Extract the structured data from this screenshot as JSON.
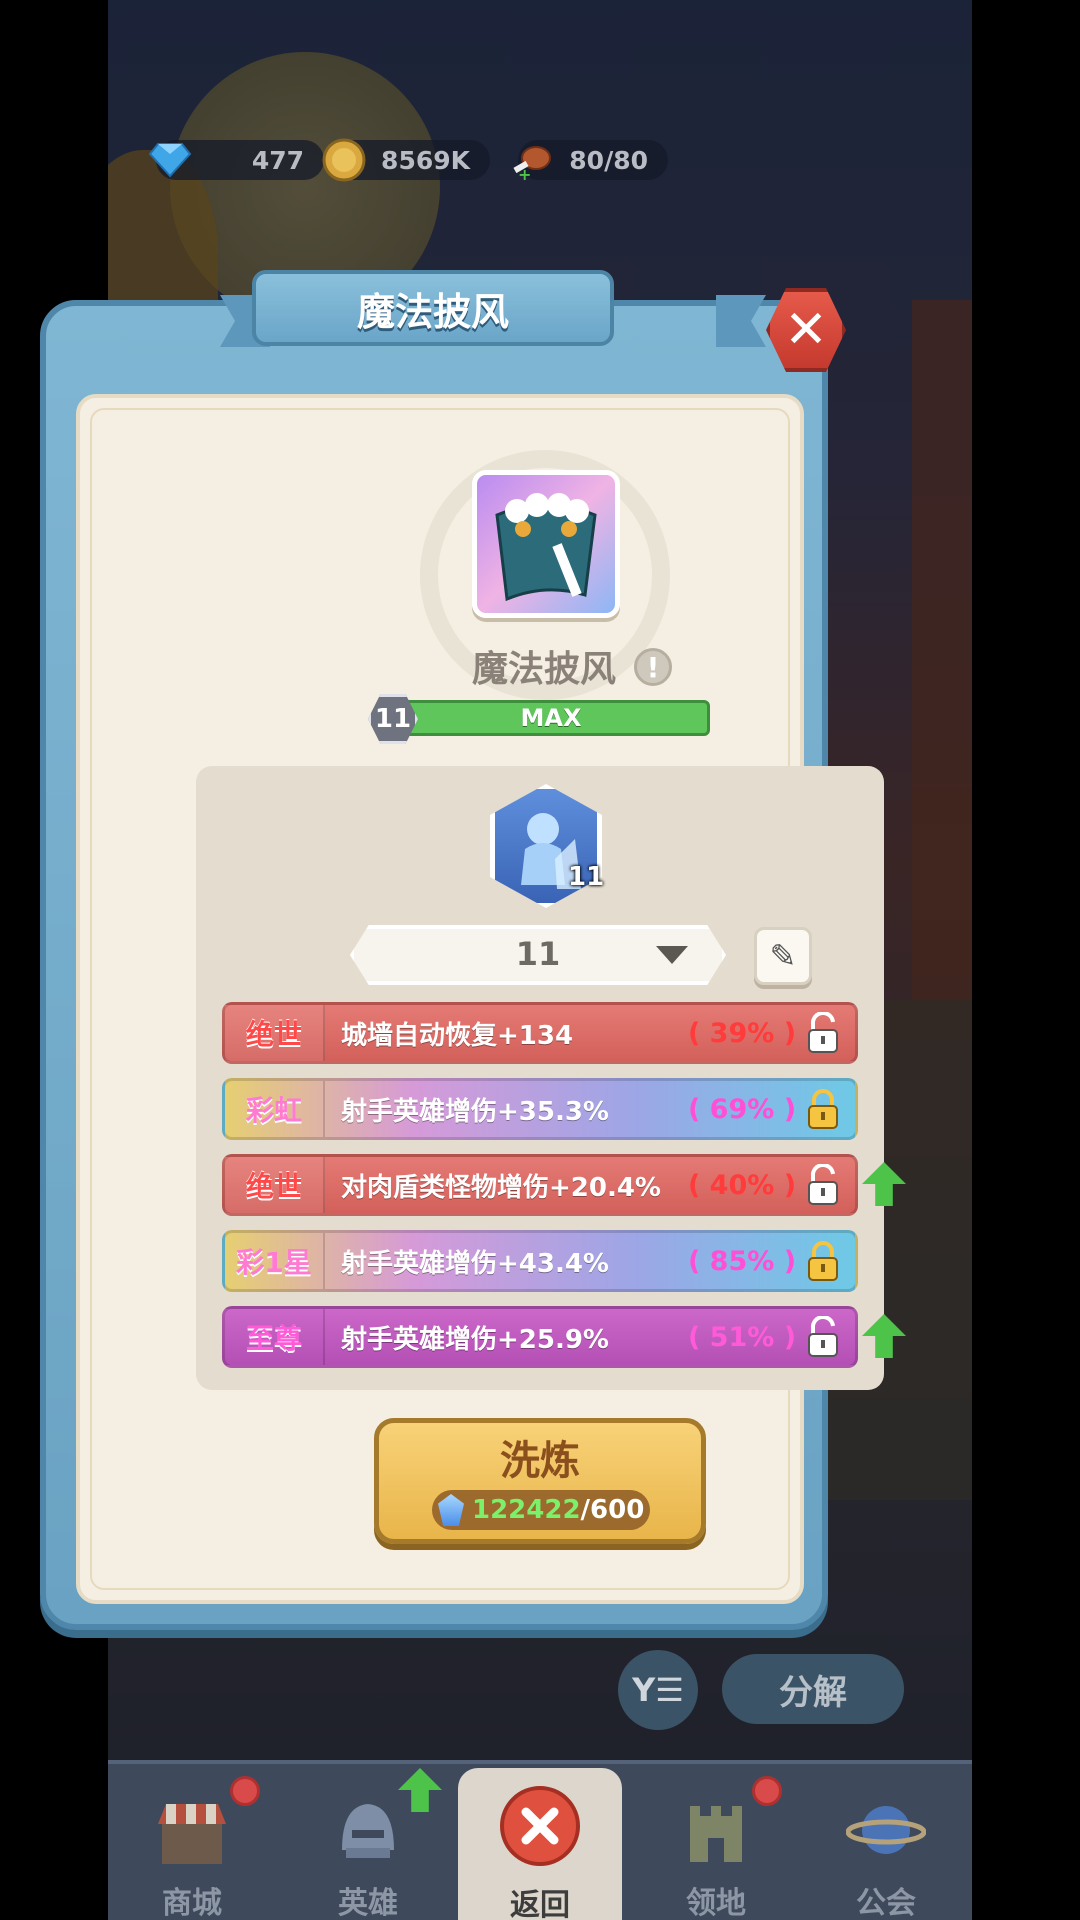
{
  "resources": {
    "gems": "477",
    "coins": "8569K",
    "stamina": "80/80"
  },
  "dialog": {
    "title": "魔法披风",
    "close_icon": "close-x-icon"
  },
  "item": {
    "name": "魔法披风",
    "level": "11",
    "level_status": "MAX",
    "info_icon": "exclamation-icon"
  },
  "rune": {
    "level": "11",
    "selected_level": "11"
  },
  "stats": [
    {
      "tag": "绝世",
      "text": "城墙自动恢复+134",
      "pct": "( 39% )",
      "locked": false,
      "upgrade": false,
      "style": "red"
    },
    {
      "tag": "彩虹",
      "text": "射手英雄增伤+35.3%",
      "pct": "( 69% )",
      "locked": true,
      "upgrade": false,
      "style": "rainbow"
    },
    {
      "tag": "绝世",
      "text": "对肉盾类怪物增伤+20.4%",
      "pct": "( 40% )",
      "locked": false,
      "upgrade": true,
      "style": "red"
    },
    {
      "tag": "彩1星",
      "text": "射手英雄增伤+43.4%",
      "pct": "( 85% )",
      "locked": true,
      "upgrade": false,
      "style": "rainbow"
    },
    {
      "tag": "至尊",
      "text": "射手英雄增伤+25.9%",
      "pct": "( 51% )",
      "locked": false,
      "upgrade": true,
      "style": "purple"
    }
  ],
  "refine": {
    "label": "洗炼",
    "current": "122422",
    "required": "/600"
  },
  "actions": {
    "filter_label": "Y☰",
    "decompose_label": "分解"
  },
  "nav": {
    "shop": "商城",
    "heroes": "英雄",
    "back": "返回",
    "territory": "领地",
    "guild": "公会"
  },
  "colors": {
    "dialog_blue": "#6aa2c3",
    "panel_cream": "#f5efe3",
    "level_green": "#5fc65c",
    "button_gold": "#e8b54a"
  }
}
